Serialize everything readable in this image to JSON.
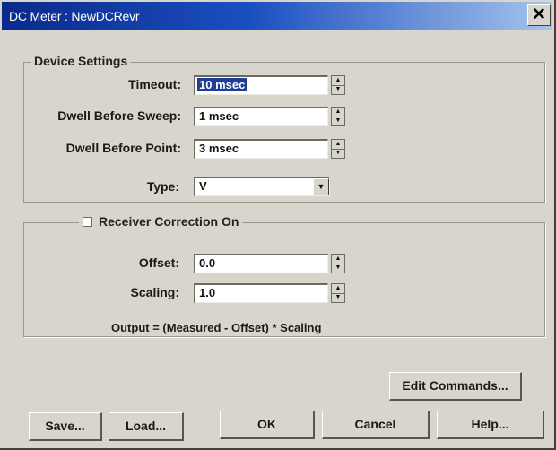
{
  "window": {
    "title": "DC Meter : NewDCRevr",
    "close_glyph": "✕"
  },
  "device_settings": {
    "group_title": "Device Settings",
    "timeout": {
      "label": "Timeout:",
      "value": "10 msec"
    },
    "dwell_sweep": {
      "label": "Dwell Before Sweep:",
      "value": "1 msec"
    },
    "dwell_point": {
      "label": "Dwell Before Point:",
      "value": "3 msec"
    },
    "type": {
      "label": "Type:",
      "value": "V"
    }
  },
  "receiver_correction": {
    "checkbox_label": "Receiver Correction On",
    "checked": false,
    "offset": {
      "label": "Offset:",
      "value": "0.0"
    },
    "scaling": {
      "label": "Scaling:",
      "value": "1.0"
    },
    "formula": "Output = (Measured - Offset) * Scaling"
  },
  "buttons": {
    "edit_commands": "Edit Commands...",
    "save": "Save...",
    "load": "Load...",
    "ok": "OK",
    "cancel": "Cancel",
    "help": "Help..."
  },
  "icons": {
    "spin_up": "▲",
    "spin_down": "▼",
    "dropdown": "▼"
  }
}
